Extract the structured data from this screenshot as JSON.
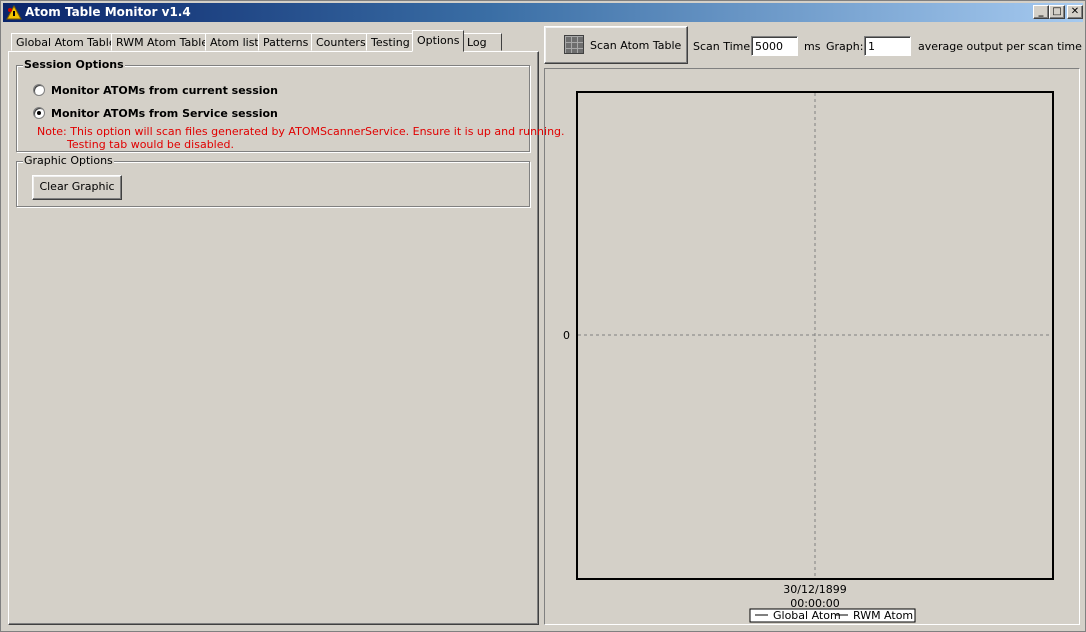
{
  "window": {
    "title": "Atom Table Monitor v1.4",
    "controls": {
      "minimize": "_",
      "maximize": "□",
      "close": "✕"
    }
  },
  "tabs": [
    {
      "label": "Global Atom Table",
      "active": false
    },
    {
      "label": "RWM Atom Table",
      "active": false
    },
    {
      "label": "Atom list",
      "active": false
    },
    {
      "label": "Patterns",
      "active": false
    },
    {
      "label": "Counters",
      "active": false
    },
    {
      "label": "Testing",
      "active": false
    },
    {
      "label": "Options",
      "active": true
    },
    {
      "label": "Log",
      "active": false
    }
  ],
  "session_options": {
    "title": "Session Options",
    "radio_current": {
      "label": "Monitor ATOMs from current session",
      "checked": false
    },
    "radio_service": {
      "label": "Monitor ATOMs from Service session",
      "checked": true
    },
    "note_line1": "Note: This option will scan files generated by ATOMScannerService. Ensure it is up and running.",
    "note_line2": "Testing tab would be disabled."
  },
  "graphic_options": {
    "title": "Graphic Options",
    "clear_button": "Clear Graphic"
  },
  "toolbar": {
    "scan_button": "Scan Atom Table",
    "scan_time_label": "Scan Time:",
    "scan_time_value": "5000",
    "scan_time_unit": "ms",
    "graph_label": "Graph:",
    "graph_value": "1",
    "graph_desc": "average output per scan time"
  },
  "colors": {
    "note": "#e00000",
    "title_gradient_start": "#0a246a",
    "title_gradient_end": "#a6caf0"
  },
  "chart_data": {
    "type": "line",
    "y_tick_labels": [
      "0"
    ],
    "x_tick_labels": [
      "30/12/1899\n00:00:00"
    ],
    "x_tick_line1": "30/12/1899",
    "x_tick_line2": "00:00:00",
    "series": [
      {
        "name": "Global Atom",
        "values": []
      },
      {
        "name": "RWM Atom",
        "values": []
      }
    ],
    "grid": true,
    "legend_position": "bottom"
  }
}
